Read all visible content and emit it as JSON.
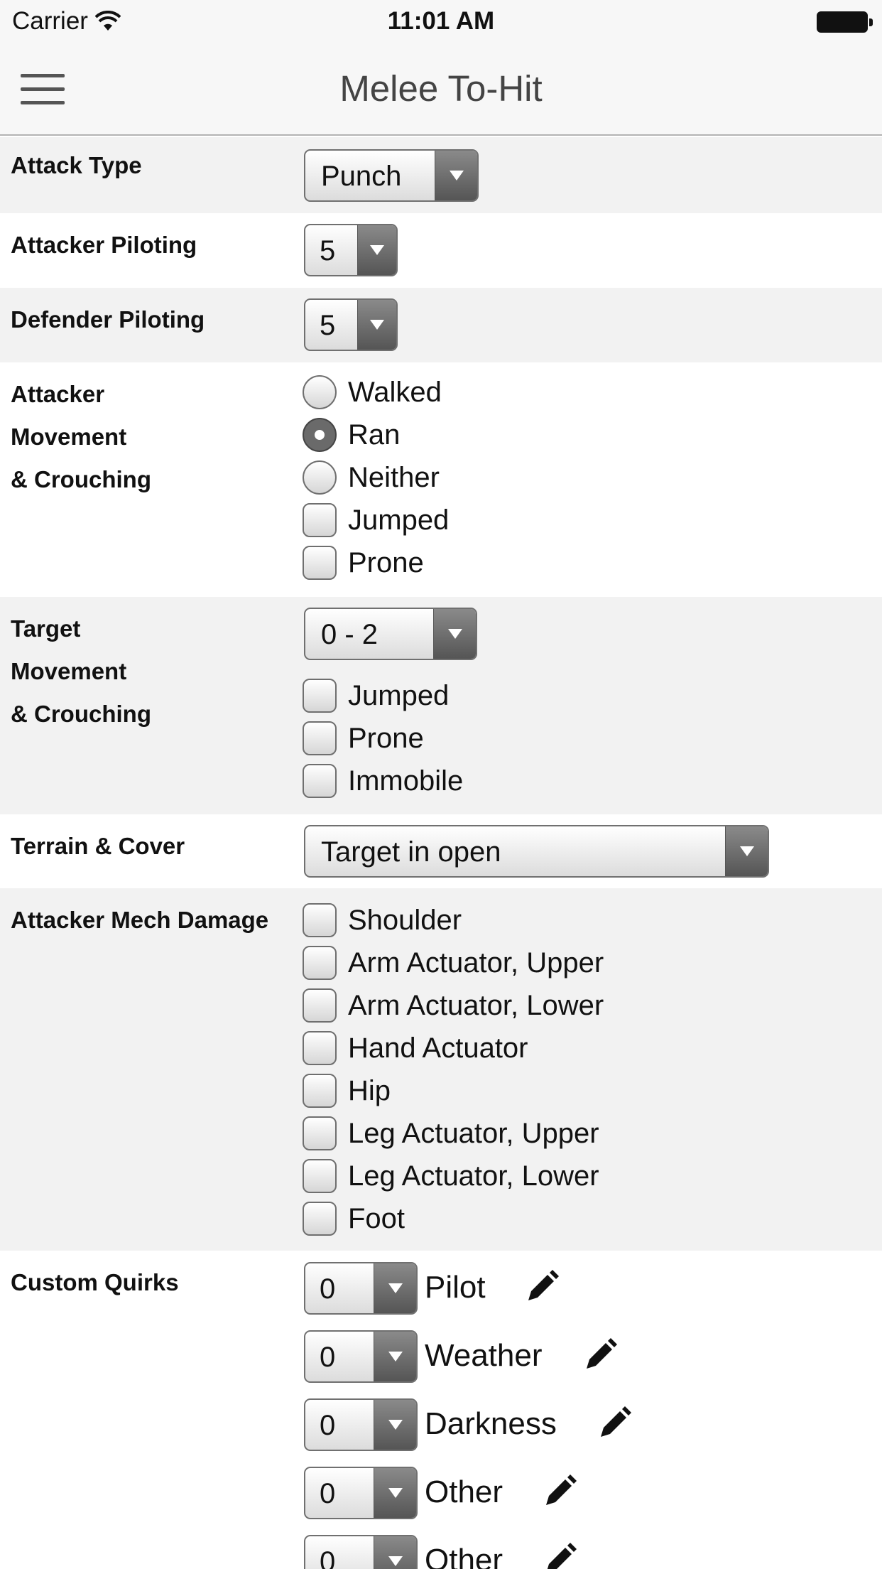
{
  "status_bar": {
    "carrier": "Carrier",
    "time": "11:01 AM"
  },
  "nav": {
    "title": "Melee To-Hit",
    "menu_icon": "hamburger-menu-icon"
  },
  "attack_type": {
    "label": "Attack Type",
    "value": "Punch"
  },
  "attacker_piloting": {
    "label": "Attacker Piloting",
    "value": "5"
  },
  "defender_piloting": {
    "label": "Defender Piloting",
    "value": "5"
  },
  "attacker_movement": {
    "label_lines": [
      "Attacker",
      "Movement",
      "& Crouching"
    ],
    "radios": [
      {
        "label": "Walked",
        "checked": false
      },
      {
        "label": "Ran",
        "checked": true
      },
      {
        "label": "Neither",
        "checked": false
      }
    ],
    "checkboxes": [
      {
        "label": "Jumped",
        "checked": false
      },
      {
        "label": "Prone",
        "checked": false
      }
    ]
  },
  "target_movement": {
    "label_lines": [
      "Target",
      "Movement",
      "& Crouching"
    ],
    "value": "0 - 2",
    "checkboxes": [
      {
        "label": "Jumped",
        "checked": false
      },
      {
        "label": "Prone",
        "checked": false
      },
      {
        "label": "Immobile",
        "checked": false
      }
    ]
  },
  "terrain": {
    "label": "Terrain & Cover",
    "value": "Target in open"
  },
  "mech_damage": {
    "label": "Attacker Mech Damage",
    "checkboxes": [
      {
        "label": "Shoulder",
        "checked": false
      },
      {
        "label": "Arm Actuator, Upper",
        "checked": false
      },
      {
        "label": "Arm Actuator, Lower",
        "checked": false
      },
      {
        "label": "Hand Actuator",
        "checked": false
      },
      {
        "label": "Hip",
        "checked": false
      },
      {
        "label": "Leg Actuator, Upper",
        "checked": false
      },
      {
        "label": "Leg Actuator, Lower",
        "checked": false
      },
      {
        "label": "Foot",
        "checked": false
      }
    ]
  },
  "custom_quirks": {
    "label": "Custom Quirks",
    "items": [
      {
        "value": "0",
        "name": "Pilot"
      },
      {
        "value": "0",
        "name": "Weather"
      },
      {
        "value": "0",
        "name": "Darkness"
      },
      {
        "value": "0",
        "name": "Other"
      },
      {
        "value": "0",
        "name": "Other"
      }
    ]
  },
  "colors": {
    "row_gray": "#f2f2f2",
    "bar": "#f7f7f7",
    "select_arrow": "#6a6a6a"
  }
}
